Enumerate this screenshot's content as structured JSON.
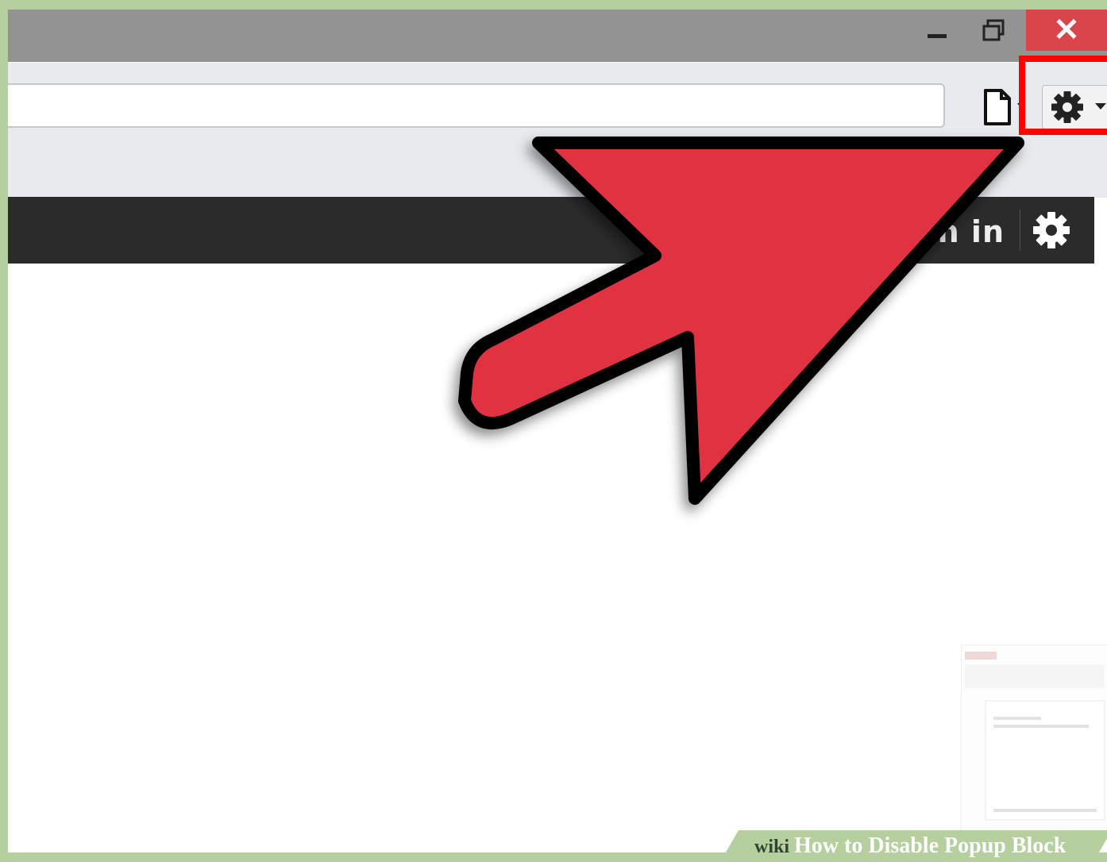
{
  "window": {
    "minimize_icon": "minimize-icon",
    "maximize_icon": "restore-icon",
    "close_label": "✕",
    "close_color": "#d9454b"
  },
  "navbar": {
    "address_value": "",
    "page_icon": "page-icon",
    "tools_icon": "gear-icon"
  },
  "toolbar": {
    "signin_partial": "gn in",
    "settings_icon": "gear-icon"
  },
  "annotation": {
    "arrow_color": "#e0303f",
    "highlight_color": "#ff0000"
  },
  "watermark": {
    "wiki": "wiki",
    "title": "How to Disable Popup Block"
  }
}
